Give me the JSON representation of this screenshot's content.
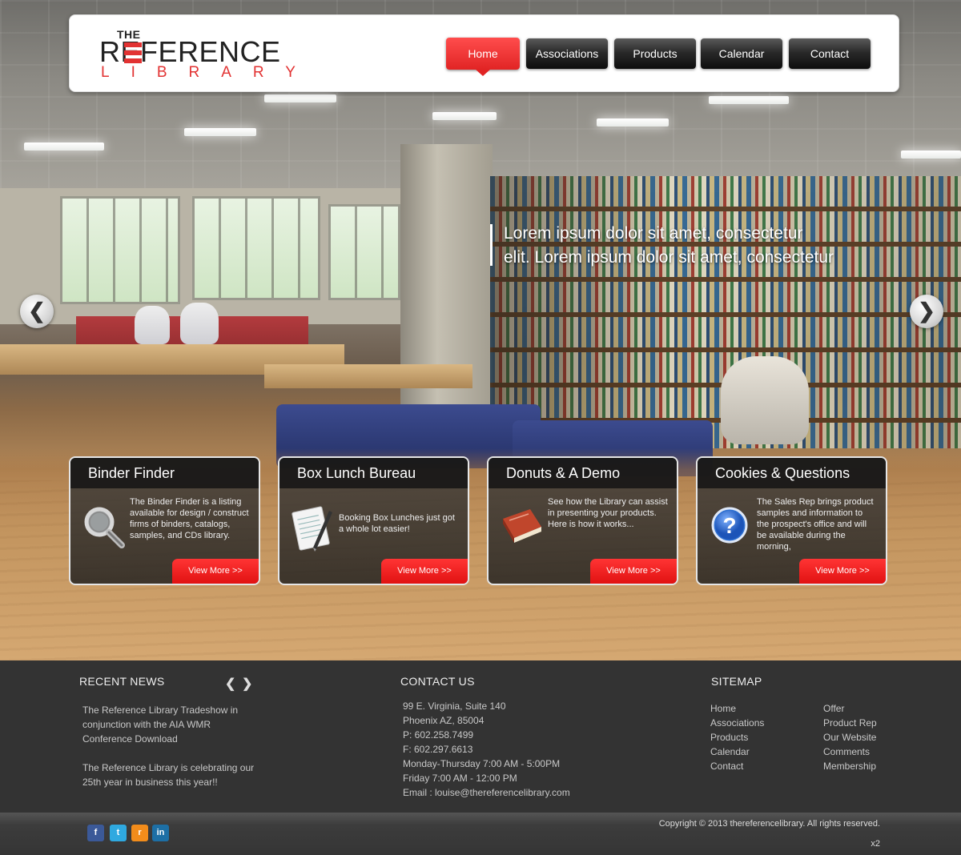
{
  "header": {
    "logo": {
      "the": "THE",
      "reference": "REFERENCE",
      "library": "LIBRARY"
    },
    "nav": [
      {
        "label": "Home",
        "active": true
      },
      {
        "label": "Associations",
        "active": false
      },
      {
        "label": "Products",
        "active": false
      },
      {
        "label": "Calendar",
        "active": false
      },
      {
        "label": "Contact",
        "active": false
      }
    ]
  },
  "slider": {
    "text_line1": "Lorem ipsum dolor sit amet, consectetur",
    "text_line2": "elit. Lorem ipsum dolor sit amet, consectetur",
    "prev_glyph": "❮",
    "next_glyph": "❯"
  },
  "features": [
    {
      "title": "Binder Finder",
      "text": "The Binder Finder is a listing available for design / construct firms of binders, catalogs, samples, and CDs library.",
      "button": "View More >>",
      "icon": "magnifier-icon"
    },
    {
      "title": "Box Lunch Bureau",
      "text": "Booking Box Lunches just got a whole lot easier!",
      "button": "View More >>",
      "icon": "notepad-pen-icon"
    },
    {
      "title": "Donuts & A Demo",
      "text": "See how the Library can assist in presenting your products.\nHere is how it works...",
      "button": "View More >>",
      "icon": "book-icon"
    },
    {
      "title": "Cookies & Questions",
      "text": "The Sales Rep brings product samples and information to the prospect's office and will be available during the morning,",
      "button": "View More >>",
      "icon": "question-icon"
    }
  ],
  "footer": {
    "recent_news": {
      "heading": "RECENT NEWS",
      "prev": "❮",
      "next": "❯",
      "items": [
        "The Reference Library Tradeshow in conjunction with the AIA WMR Conference Download",
        "The Reference Library is celebrating our 25th year in business this year!!"
      ]
    },
    "contact": {
      "heading": "CONTACT US",
      "lines": [
        "99 E. Virginia, Suite 140",
        "Phoenix AZ, 85004",
        "P: 602.258.7499",
        "F: 602.297.6613",
        "Monday-Thursday 7:00 AM - 5:00PM",
        "Friday 7:00 AM - 12:00 PM",
        "Email : louise@thereferencelibrary.com"
      ]
    },
    "sitemap": {
      "heading": "SITEMAP",
      "col1": [
        "Home",
        "Associations",
        "Products",
        "Calendar",
        "Contact"
      ],
      "col2": [
        "Offer",
        "Product Rep",
        "Our Website",
        "Comments",
        "Membership"
      ]
    }
  },
  "bottom": {
    "social": [
      {
        "name": "facebook-icon",
        "glyph": "f",
        "color": "#3b5998"
      },
      {
        "name": "twitter-icon",
        "glyph": "t",
        "color": "#2fa9e0"
      },
      {
        "name": "rss-icon",
        "glyph": "r",
        "color": "#f28c1b"
      },
      {
        "name": "linkedin-icon",
        "glyph": "in",
        "color": "#1d6fa5"
      }
    ],
    "copyright": "Copyright ©  2013  thereferencelibrary. All rights reserved.",
    "badge": "x2"
  },
  "colors": {
    "accent": "#e12424",
    "footer_bg": "#333333"
  }
}
